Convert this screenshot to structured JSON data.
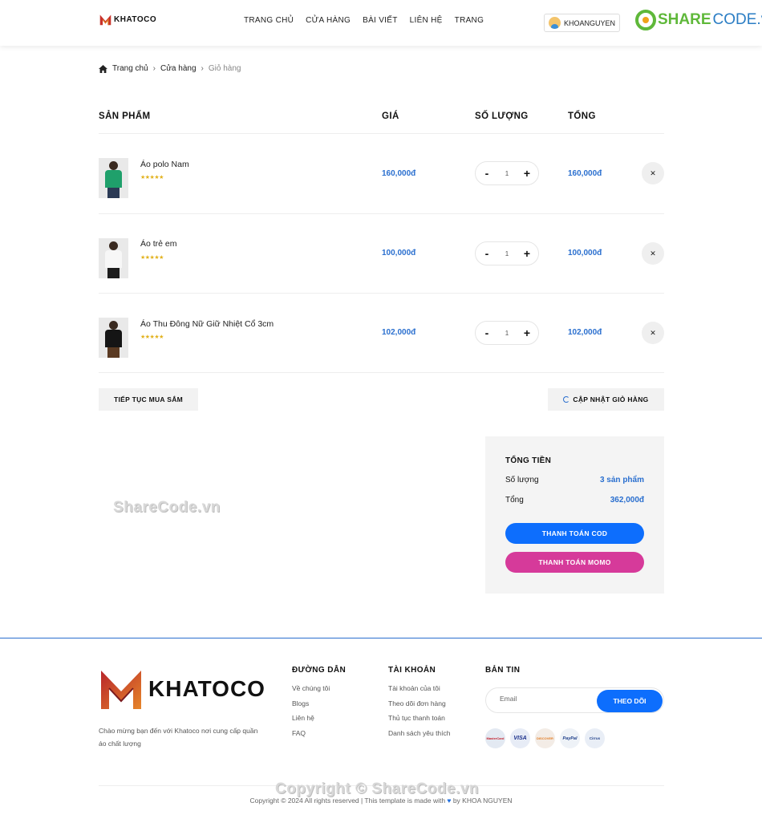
{
  "header": {
    "logo_text": "KHATOCO",
    "nav": [
      "TRANG CHỦ",
      "CỬA HÀNG",
      "BÀI VIẾT",
      "LIÊN HỆ",
      "TRANG"
    ],
    "username": "KHOANGUYEN",
    "sharecode_share": "SHARE",
    "sharecode_code": "CODE.vn"
  },
  "breadcrumb": {
    "home": "Trang chủ",
    "shop": "Cửa hàng",
    "current": "Giỏ hàng",
    "sep": "›"
  },
  "table": {
    "headers": {
      "product": "SẢN PHẨM",
      "price": "GIÁ",
      "qty": "SỐ LƯỢNG",
      "total": "TỔNG"
    },
    "rows": [
      {
        "name": "Áo polo Nam",
        "stars": "★★★★★",
        "price": "160,000đ",
        "qty": "1",
        "total": "160,000đ"
      },
      {
        "name": "Áo trẻ em",
        "stars": "★★★★★",
        "price": "100,000đ",
        "qty": "1",
        "total": "100,000đ"
      },
      {
        "name": "Áo Thu Đông Nữ Giữ Nhiệt Cổ 3cm",
        "stars": "★★★★★",
        "price": "102,000đ",
        "qty": "1",
        "total": "102,000đ"
      }
    ],
    "minus": "-",
    "plus": "+",
    "remove": "✕"
  },
  "actions": {
    "continue": "TIẾP TỤC MUA SẮM",
    "update": "CẬP NHẬT GIỎ HÀNG"
  },
  "summary": {
    "title": "TỔNG TIỀN",
    "qty_label": "Số lượng",
    "qty_value": "3 sản phẩm",
    "total_label": "Tổng",
    "total_value": "362,000đ",
    "cod": "THANH TOÁN COD",
    "momo": "THANH TOÁN MOMO"
  },
  "watermark": "ShareCode.vn",
  "footer": {
    "logo_text": "KHATOCO",
    "desc": "Chào mừng bạn đến với Khatoco nơi cung cấp quần áo chất lượng",
    "col1": {
      "title": "ĐƯỜNG DẪN",
      "links": [
        "Về chúng tôi",
        "Blogs",
        "Liên hệ",
        "FAQ"
      ]
    },
    "col2": {
      "title": "TÀI KHOẢN",
      "links": [
        "Tài khoản của tôi",
        "Theo dõi đơn hàng",
        "Thủ tục thanh toán",
        "Danh sách yêu thích"
      ]
    },
    "newsletter": {
      "title": "BẢN TIN",
      "placeholder": "Email",
      "button": "THEO DÕI"
    },
    "cards": [
      "MasterCard",
      "VISA",
      "DISCOVER",
      "PayPal",
      "Cirrus"
    ],
    "watermark": "Copyright © ShareCode.vn",
    "copyright_prefix": "Copyright © 2024 All rights reserved | This template is made with ",
    "heart": "♥",
    "copyright_suffix": " by KHOA NGUYEN"
  },
  "colors": {
    "accent": "#2a6fcf",
    "cod": "#0d6efd",
    "momo": "#d63a9a",
    "star": "#e2b21e",
    "footer_line": "#2a6fcf"
  }
}
